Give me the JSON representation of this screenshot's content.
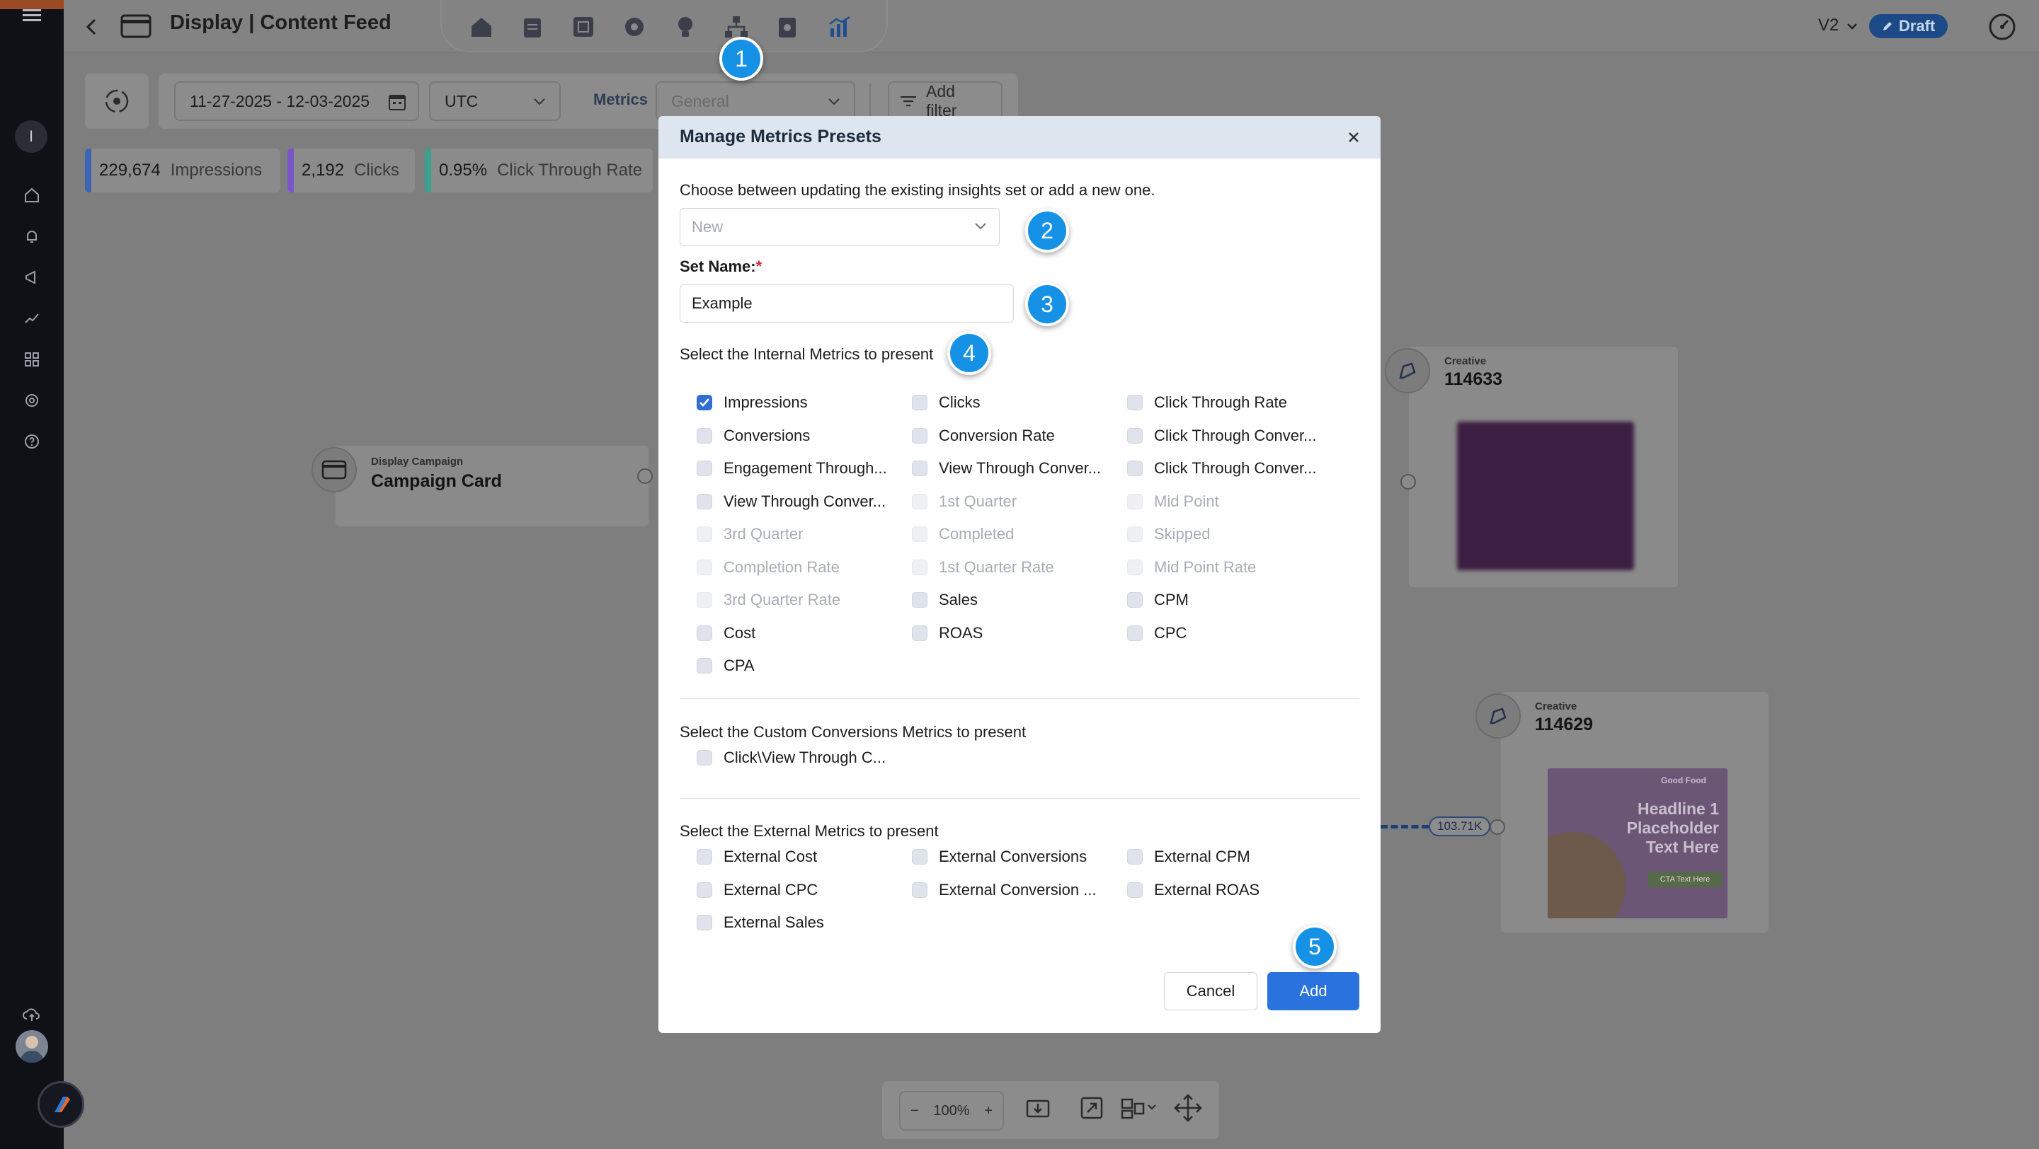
{
  "header": {
    "title": "Display | Content Feed",
    "version": "V2",
    "status": "Draft"
  },
  "sidebar": {
    "user_initial": "I"
  },
  "toolbar": {
    "date_range": "11-27-2025 - 12-03-2025",
    "timezone": "UTC",
    "metrics_label": "Metrics",
    "metrics_value": "General",
    "add_filter": "Add filter"
  },
  "stats": [
    {
      "value": "229,674",
      "label": "Impressions",
      "color": "#3e64b5"
    },
    {
      "value": "2,192",
      "label": "Clicks",
      "color": "#7a56c9"
    },
    {
      "value": "0.95%",
      "label": "Click Through Rate",
      "color": "#3aa38f"
    }
  ],
  "canvas": {
    "campaign": {
      "type": "Display Campaign",
      "name": "Campaign Card"
    },
    "creative_a": {
      "type": "Creative",
      "id": "114633"
    },
    "creative_b": {
      "type": "Creative",
      "id": "114629",
      "edge_label": "103.71K"
    },
    "ad": {
      "brand": "Good Food",
      "headline": "Headline 1 Placeholder Text Here",
      "cta": "CTA Text Here"
    }
  },
  "zoom": {
    "level": "100%",
    "minus": "−",
    "plus": "+"
  },
  "modal": {
    "title": "Manage Metrics Presets",
    "intro": "Choose between updating the existing insights set or add a new one.",
    "mode_value": "New",
    "set_name_label": "Set Name:",
    "required_mark": "*",
    "set_name_value": "Example",
    "internal_label": "Select the Internal Metrics to present",
    "internal_metrics": [
      {
        "label": "Impressions",
        "state": "checked"
      },
      {
        "label": "Clicks",
        "state": "unchecked"
      },
      {
        "label": "Click Through Rate",
        "state": "unchecked"
      },
      {
        "label": "Conversions",
        "state": "unchecked"
      },
      {
        "label": "Conversion Rate",
        "state": "unchecked"
      },
      {
        "label": "Click Through Conver...",
        "state": "unchecked"
      },
      {
        "label": "Engagement Through...",
        "state": "unchecked"
      },
      {
        "label": "View Through Conver...",
        "state": "unchecked"
      },
      {
        "label": "Click Through Conver...",
        "state": "unchecked"
      },
      {
        "label": "View Through Conver...",
        "state": "unchecked"
      },
      {
        "label": "1st Quarter",
        "state": "disabled"
      },
      {
        "label": "Mid Point",
        "state": "disabled"
      },
      {
        "label": "3rd Quarter",
        "state": "disabled"
      },
      {
        "label": "Completed",
        "state": "disabled"
      },
      {
        "label": "Skipped",
        "state": "disabled"
      },
      {
        "label": "Completion Rate",
        "state": "disabled"
      },
      {
        "label": "1st Quarter Rate",
        "state": "disabled"
      },
      {
        "label": "Mid Point Rate",
        "state": "disabled"
      },
      {
        "label": "3rd Quarter Rate",
        "state": "disabled"
      },
      {
        "label": "Sales",
        "state": "unchecked"
      },
      {
        "label": "CPM",
        "state": "unchecked"
      },
      {
        "label": "Cost",
        "state": "unchecked"
      },
      {
        "label": "ROAS",
        "state": "unchecked"
      },
      {
        "label": "CPC",
        "state": "unchecked"
      },
      {
        "label": "CPA",
        "state": "unchecked"
      }
    ],
    "custom_label": "Select the Custom Conversions Metrics to present",
    "custom_metrics": [
      {
        "label": "Click\\View Through C...",
        "state": "unchecked"
      }
    ],
    "external_label": "Select the External Metrics to present",
    "external_metrics": [
      {
        "label": "External Cost",
        "state": "unchecked"
      },
      {
        "label": "External Conversions",
        "state": "unchecked"
      },
      {
        "label": "External CPM",
        "state": "unchecked"
      },
      {
        "label": "External CPC",
        "state": "unchecked"
      },
      {
        "label": "External Conversion ...",
        "state": "unchecked"
      },
      {
        "label": "External ROAS",
        "state": "unchecked"
      },
      {
        "label": "External Sales",
        "state": "unchecked"
      }
    ],
    "cancel": "Cancel",
    "add": "Add"
  },
  "badges": [
    "1",
    "2",
    "3",
    "4",
    "5"
  ]
}
